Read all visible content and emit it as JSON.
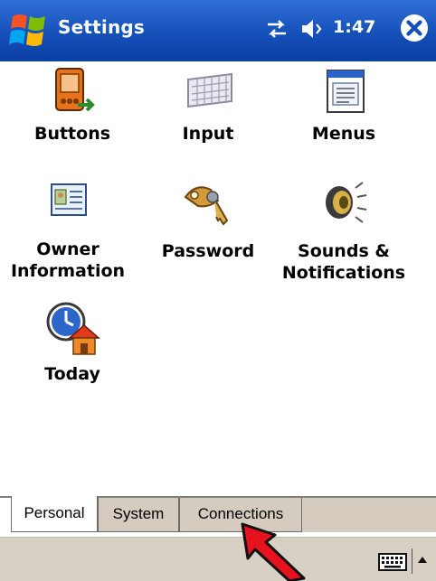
{
  "titlebar": {
    "title": "Settings",
    "clock": "1:47"
  },
  "grid": {
    "items": [
      {
        "label": "Buttons",
        "icon": "buttons-icon"
      },
      {
        "label": "Input",
        "icon": "keyboard-icon"
      },
      {
        "label": "Menus",
        "icon": "menus-icon"
      },
      {
        "label": "Owner\nInformation",
        "icon": "owner-card-icon"
      },
      {
        "label": "Password",
        "icon": "keys-icon"
      },
      {
        "label": "Sounds &\nNotifications",
        "icon": "speaker-icon"
      },
      {
        "label": "Today",
        "icon": "today-clock-house-icon"
      }
    ]
  },
  "tabs": [
    {
      "label": "Personal",
      "active": true
    },
    {
      "label": "System",
      "active": false
    },
    {
      "label": "Connections",
      "active": false
    }
  ],
  "colors": {
    "titlebar": "#1550b9",
    "tab_inactive": "#d5ccbf",
    "menubar": "#d8d0c4",
    "annotation_arrow": "#e8121e"
  }
}
